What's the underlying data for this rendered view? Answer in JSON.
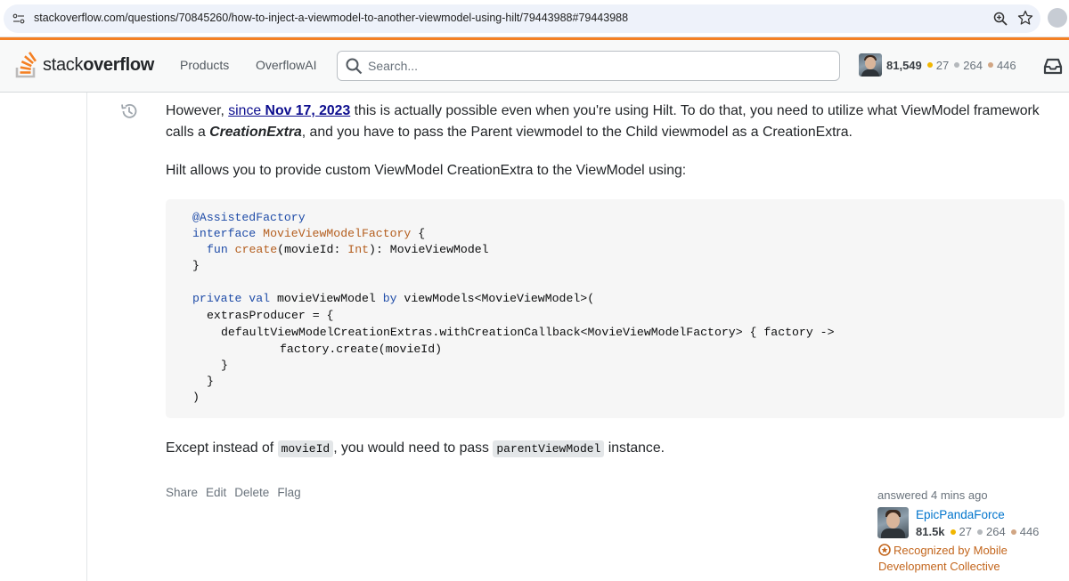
{
  "browser": {
    "url": "stackoverflow.com/questions/70845260/how-to-inject-a-viewmodel-to-another-viewmodel-using-hilt/79443988#79443988"
  },
  "topbar": {
    "logo_plain": "stack",
    "logo_bold": "overflow",
    "nav_products": "Products",
    "nav_overflowai": "OverflowAI",
    "search_placeholder": "Search...",
    "user": {
      "reputation": "81,549",
      "gold": "27",
      "silver": "264",
      "bronze": "446"
    }
  },
  "post": {
    "p1": {
      "before_link": "However, ",
      "link_plain": "since ",
      "link_bold": "Nov 17, 2023",
      "after_link": " this is actually possible even when you're using Hilt. To do that, you need to utilize what ViewModel framework calls a ",
      "emphasis": "CreationExtra",
      "end": ", and you have to pass the Parent viewmodel to the Child viewmodel as a CreationExtra."
    },
    "p2": "Hilt allows you to provide custom ViewModel CreationExtra to the ViewModel using:",
    "code": {
      "l1": "@AssistedFactory",
      "l2_kw": "interface",
      "l2_name": "MovieViewModelFactory",
      "l2_rest": " {",
      "l3_kw": "fun",
      "l3_fn": "create",
      "l3_a": "(movieId: ",
      "l3_type": "Int",
      "l3_b": "): MovieViewModel",
      "l4": "}",
      "l5_kw": "private val",
      "l5_a": " movieViewModel ",
      "l5_by": "by",
      "l5_b": " viewModels<MovieViewModel>(",
      "l6": "extrasProducer = {",
      "l7": "defaultViewModelCreationExtras.withCreationCallback<MovieViewModelFactory> { factory ->",
      "l8": "factory.create(movieId)",
      "l9": "}",
      "l10": "}",
      "l11": ")"
    },
    "p3": {
      "a": "Except instead of ",
      "code1": "movieId",
      "b": ", you would need to pass ",
      "code2": "parentViewModel",
      "c": " instance."
    },
    "menu": {
      "share": "Share",
      "edit": "Edit",
      "delete": "Delete",
      "flag": "Flag"
    },
    "signature": {
      "answered": "answered 4 mins ago",
      "name": "EpicPandaForce",
      "rep": "81.5k",
      "gold": "27",
      "silver": "264",
      "bronze": "446",
      "collective_line1": "Recognized by Mobile",
      "collective_line2": "Development Collective"
    }
  },
  "colors": {
    "accent_orange": "#f48024",
    "gold": "#f1b600",
    "silver": "#9a9fa4",
    "bronze": "#c38b5f",
    "link": "#0c0d8e",
    "collective": "#c3661d"
  }
}
